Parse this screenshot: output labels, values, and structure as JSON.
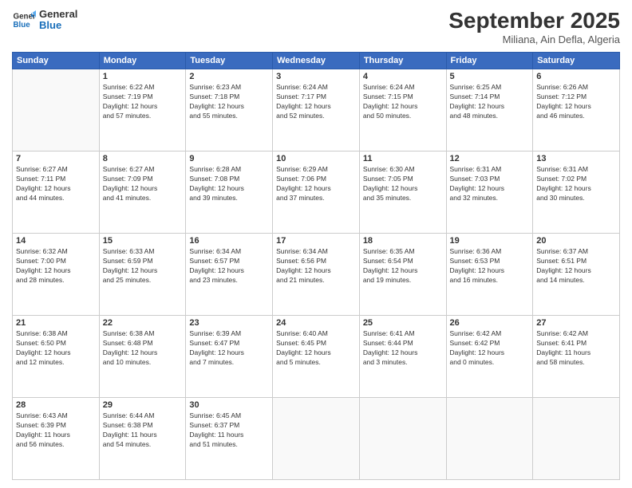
{
  "header": {
    "logo_line1": "General",
    "logo_line2": "Blue",
    "month": "September 2025",
    "location": "Miliana, Ain Defla, Algeria"
  },
  "weekdays": [
    "Sunday",
    "Monday",
    "Tuesday",
    "Wednesday",
    "Thursday",
    "Friday",
    "Saturday"
  ],
  "rows": [
    [
      {
        "day": "",
        "text": ""
      },
      {
        "day": "1",
        "text": "Sunrise: 6:22 AM\nSunset: 7:19 PM\nDaylight: 12 hours\nand 57 minutes."
      },
      {
        "day": "2",
        "text": "Sunrise: 6:23 AM\nSunset: 7:18 PM\nDaylight: 12 hours\nand 55 minutes."
      },
      {
        "day": "3",
        "text": "Sunrise: 6:24 AM\nSunset: 7:17 PM\nDaylight: 12 hours\nand 52 minutes."
      },
      {
        "day": "4",
        "text": "Sunrise: 6:24 AM\nSunset: 7:15 PM\nDaylight: 12 hours\nand 50 minutes."
      },
      {
        "day": "5",
        "text": "Sunrise: 6:25 AM\nSunset: 7:14 PM\nDaylight: 12 hours\nand 48 minutes."
      },
      {
        "day": "6",
        "text": "Sunrise: 6:26 AM\nSunset: 7:12 PM\nDaylight: 12 hours\nand 46 minutes."
      }
    ],
    [
      {
        "day": "7",
        "text": "Sunrise: 6:27 AM\nSunset: 7:11 PM\nDaylight: 12 hours\nand 44 minutes."
      },
      {
        "day": "8",
        "text": "Sunrise: 6:27 AM\nSunset: 7:09 PM\nDaylight: 12 hours\nand 41 minutes."
      },
      {
        "day": "9",
        "text": "Sunrise: 6:28 AM\nSunset: 7:08 PM\nDaylight: 12 hours\nand 39 minutes."
      },
      {
        "day": "10",
        "text": "Sunrise: 6:29 AM\nSunset: 7:06 PM\nDaylight: 12 hours\nand 37 minutes."
      },
      {
        "day": "11",
        "text": "Sunrise: 6:30 AM\nSunset: 7:05 PM\nDaylight: 12 hours\nand 35 minutes."
      },
      {
        "day": "12",
        "text": "Sunrise: 6:31 AM\nSunset: 7:03 PM\nDaylight: 12 hours\nand 32 minutes."
      },
      {
        "day": "13",
        "text": "Sunrise: 6:31 AM\nSunset: 7:02 PM\nDaylight: 12 hours\nand 30 minutes."
      }
    ],
    [
      {
        "day": "14",
        "text": "Sunrise: 6:32 AM\nSunset: 7:00 PM\nDaylight: 12 hours\nand 28 minutes."
      },
      {
        "day": "15",
        "text": "Sunrise: 6:33 AM\nSunset: 6:59 PM\nDaylight: 12 hours\nand 25 minutes."
      },
      {
        "day": "16",
        "text": "Sunrise: 6:34 AM\nSunset: 6:57 PM\nDaylight: 12 hours\nand 23 minutes."
      },
      {
        "day": "17",
        "text": "Sunrise: 6:34 AM\nSunset: 6:56 PM\nDaylight: 12 hours\nand 21 minutes."
      },
      {
        "day": "18",
        "text": "Sunrise: 6:35 AM\nSunset: 6:54 PM\nDaylight: 12 hours\nand 19 minutes."
      },
      {
        "day": "19",
        "text": "Sunrise: 6:36 AM\nSunset: 6:53 PM\nDaylight: 12 hours\nand 16 minutes."
      },
      {
        "day": "20",
        "text": "Sunrise: 6:37 AM\nSunset: 6:51 PM\nDaylight: 12 hours\nand 14 minutes."
      }
    ],
    [
      {
        "day": "21",
        "text": "Sunrise: 6:38 AM\nSunset: 6:50 PM\nDaylight: 12 hours\nand 12 minutes."
      },
      {
        "day": "22",
        "text": "Sunrise: 6:38 AM\nSunset: 6:48 PM\nDaylight: 12 hours\nand 10 minutes."
      },
      {
        "day": "23",
        "text": "Sunrise: 6:39 AM\nSunset: 6:47 PM\nDaylight: 12 hours\nand 7 minutes."
      },
      {
        "day": "24",
        "text": "Sunrise: 6:40 AM\nSunset: 6:45 PM\nDaylight: 12 hours\nand 5 minutes."
      },
      {
        "day": "25",
        "text": "Sunrise: 6:41 AM\nSunset: 6:44 PM\nDaylight: 12 hours\nand 3 minutes."
      },
      {
        "day": "26",
        "text": "Sunrise: 6:42 AM\nSunset: 6:42 PM\nDaylight: 12 hours\nand 0 minutes."
      },
      {
        "day": "27",
        "text": "Sunrise: 6:42 AM\nSunset: 6:41 PM\nDaylight: 11 hours\nand 58 minutes."
      }
    ],
    [
      {
        "day": "28",
        "text": "Sunrise: 6:43 AM\nSunset: 6:39 PM\nDaylight: 11 hours\nand 56 minutes."
      },
      {
        "day": "29",
        "text": "Sunrise: 6:44 AM\nSunset: 6:38 PM\nDaylight: 11 hours\nand 54 minutes."
      },
      {
        "day": "30",
        "text": "Sunrise: 6:45 AM\nSunset: 6:37 PM\nDaylight: 11 hours\nand 51 minutes."
      },
      {
        "day": "",
        "text": ""
      },
      {
        "day": "",
        "text": ""
      },
      {
        "day": "",
        "text": ""
      },
      {
        "day": "",
        "text": ""
      }
    ]
  ]
}
